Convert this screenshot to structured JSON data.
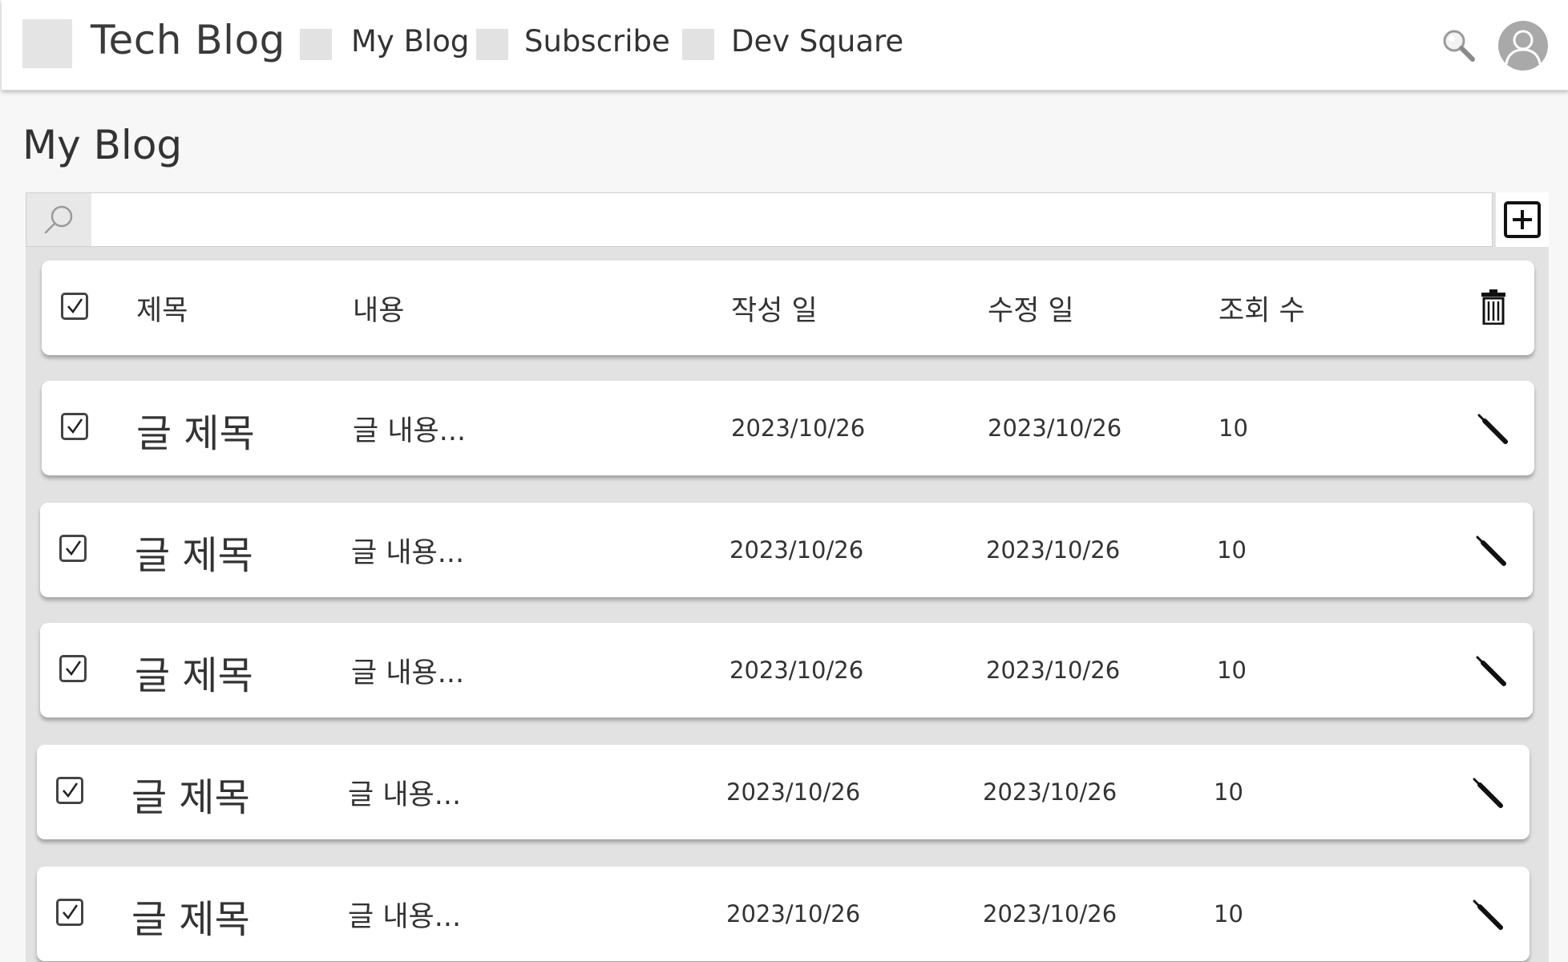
{
  "header": {
    "brand": "Tech Blog",
    "nav": [
      {
        "label": "My Blog"
      },
      {
        "label": "Subscribe"
      },
      {
        "label": "Dev Square"
      }
    ],
    "icons": {
      "search": "search-icon",
      "avatar": "user-avatar-icon"
    }
  },
  "page": {
    "title": "My Blog"
  },
  "search": {
    "placeholder": "",
    "value": ""
  },
  "table": {
    "columns": [
      "제목",
      "내용",
      "작성 일",
      "수정 일",
      "조회 수"
    ],
    "header_action_icon": "trash-icon",
    "row_action_icon": "pencil-icon",
    "rows": [
      {
        "title": "글 제목",
        "content": "글 내용...",
        "created": "2023/10/26",
        "modified": "2023/10/26",
        "views": "10",
        "checked": true
      },
      {
        "title": "글 제목",
        "content": "글 내용...",
        "created": "2023/10/26",
        "modified": "2023/10/26",
        "views": "10",
        "checked": true
      },
      {
        "title": "글 제목",
        "content": "글 내용...",
        "created": "2023/10/26",
        "modified": "2023/10/26",
        "views": "10",
        "checked": true
      },
      {
        "title": "글 제목",
        "content": "글 내용...",
        "created": "2023/10/26",
        "modified": "2023/10/26",
        "views": "10",
        "checked": true
      },
      {
        "title": "글 제목",
        "content": "글 내용...",
        "created": "2023/10/26",
        "modified": "2023/10/26",
        "views": "10",
        "checked": true
      }
    ]
  },
  "colors": {
    "header_bg": "#ffffff",
    "panel_bg": "#e2e2e2",
    "placeholder_box": "#e2e2e2",
    "avatar": "#a9a9a9"
  }
}
